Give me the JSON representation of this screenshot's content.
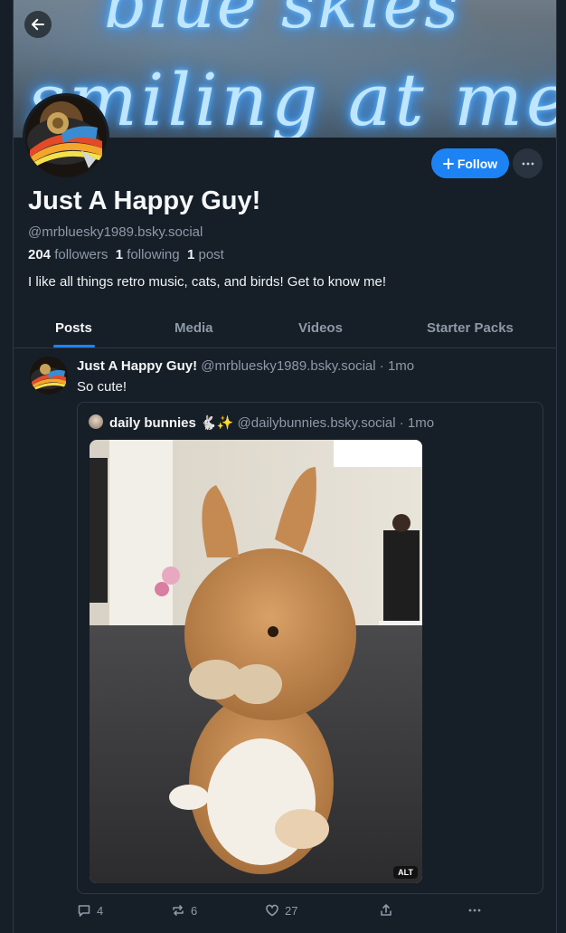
{
  "banner": {
    "neon_line1": "blue skies",
    "neon_line2": "smiling at me"
  },
  "profile": {
    "follow_label": "Follow",
    "display_name": "Just A Happy Guy!",
    "handle": "@mrbluesky1989.bsky.social",
    "followers_count": "204",
    "followers_label": "followers",
    "following_count": "1",
    "following_label": "following",
    "posts_count": "1",
    "posts_label": "post",
    "bio": "I like all things retro music, cats, and birds! Get to know me!"
  },
  "tabs": [
    {
      "label": "Posts",
      "active": true
    },
    {
      "label": "Media"
    },
    {
      "label": "Videos"
    },
    {
      "label": "Starter Packs"
    }
  ],
  "post": {
    "author_name": "Just A Happy Guy!",
    "author_handle": "@mrbluesky1989.bsky.social",
    "time": "· 1mo",
    "text": "So cute!",
    "quote": {
      "author_name": "daily bunnies 🐇✨",
      "author_handle": "@dailybunnies.bsky.social",
      "time": "· 1mo",
      "alt_badge": "ALT"
    },
    "replies": "4",
    "reposts": "6",
    "likes": "27"
  },
  "colors": {
    "accent": "#1d83f5",
    "background": "#161e27",
    "muted": "#8d9aa8"
  }
}
